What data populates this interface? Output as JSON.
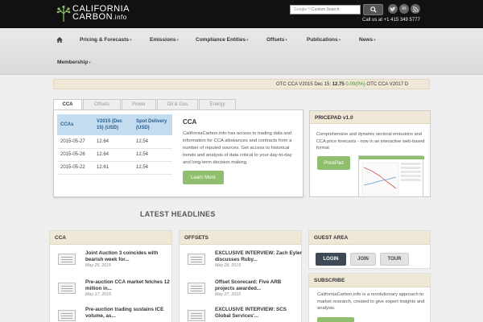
{
  "header": {
    "logo_line1": "CALIFORNIA",
    "logo_line2": "CARBON",
    "logo_suffix": ".info",
    "search_brand": "Google™",
    "search_placeholder": "Custom Search",
    "search_icon": "search-icon",
    "social": [
      "twitter-icon",
      "linkedin-icon",
      "rss-icon"
    ],
    "call_us": "Call us at +1 415 349 5777"
  },
  "nav": {
    "home_icon": "home-icon",
    "items": [
      {
        "label": "Pricing & Forecasts",
        "caret": "▾"
      },
      {
        "label": "Emissions",
        "caret": "▾"
      },
      {
        "label": "Compliance Entities",
        "caret": "▾"
      },
      {
        "label": "Offsets",
        "caret": "▾"
      },
      {
        "label": "Publications",
        "caret": "▾"
      },
      {
        "label": "News",
        "caret": "▾"
      },
      {
        "label": "Membership",
        "caret": "▾"
      }
    ]
  },
  "ticker": {
    "prefix": "OTC CCA V2015 Dec 15: ",
    "price": "12.75",
    "change": "0.00(0%)",
    "suffix": " OTC CCA V2017 D"
  },
  "tabs": [
    "CCA",
    "Offsets",
    "Power",
    "Oil & Gas",
    "Energy"
  ],
  "cca_table": {
    "headers": [
      "CCAs",
      "V2015 (Dec 15) (USD)",
      "Spot Delivery (USD)"
    ],
    "rows": [
      [
        "2015-05-27",
        "12.64",
        "12.54"
      ],
      [
        "2015-05-26",
        "12.64",
        "12.54"
      ],
      [
        "2015-05-22",
        "12.61",
        "12.54"
      ]
    ]
  },
  "cca_info": {
    "title": "CCA",
    "description": "CaliforniaCarbon.info has access to trading data and information for CCA allowances and contracts from a number of reputed sources. Get access to historical trends and analysis of data critical to your day-to-day and long-term decision making.",
    "button": "Learn More"
  },
  "pricepad": {
    "title": "PRICEPAD v1.0",
    "description": "Comprehensive and dynamic sectoral emissions and CCA price forecasts - now in an interactive web-based format",
    "button": "PricePad"
  },
  "latest_headlines": "LATEST HEADLINES",
  "news_cca": {
    "title": "CCA",
    "items": [
      {
        "title": "Joint Auction 3 coincides with bearish week for...",
        "date": "May 25, 2015"
      },
      {
        "title": "Pre-auction CCA market fetches 12 million in...",
        "date": "May 17, 2015"
      },
      {
        "title": "Pre-auction trading sustains ICE volume, as...",
        "date": ""
      }
    ]
  },
  "news_offsets": {
    "title": "OFFSETS",
    "items": [
      {
        "title": "EXCLUSIVE INTERVIEW: Zach Eyler discusses Ruby...",
        "date": "May 28, 2015"
      },
      {
        "title": "Offset Scorecard: Five ARB projects awarded...",
        "date": "May 27, 2015"
      },
      {
        "title": "EXCLUSIVE INTERVIEW: SCS Global Services'...",
        "date": ""
      }
    ]
  },
  "guest_area": {
    "title": "GUEST AREA",
    "buttons": [
      "LOGIN",
      "JOIN",
      "TOUR"
    ]
  },
  "subscribe": {
    "title": "SUBSCRIBE",
    "description": "CaliforniaCarbon.info is a revolutionary approach to market research, created to give expert insights and analysis."
  },
  "colors": {
    "header_bg": "#111111",
    "panel_head": "#f0e8d6",
    "accent_green": "#8fbf6e",
    "table_head": "#c4dcef",
    "ticker_positive": "#3a8a2a"
  }
}
